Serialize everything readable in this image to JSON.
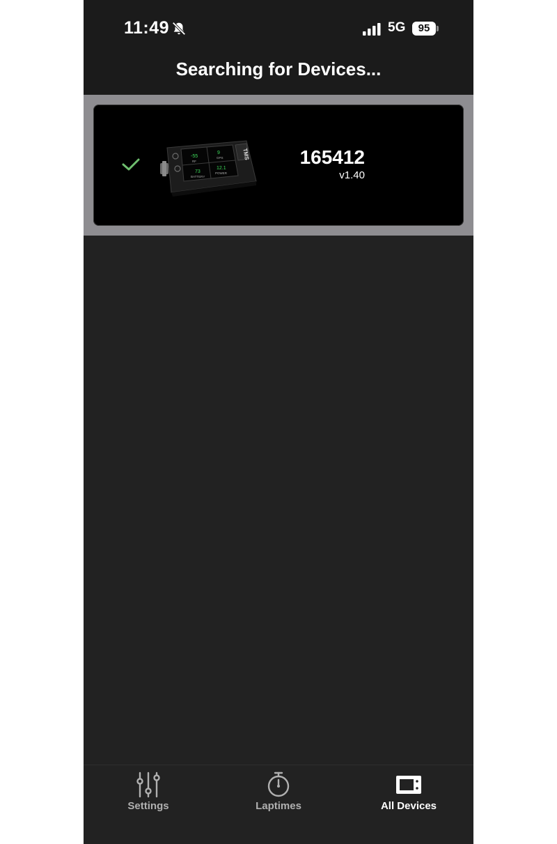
{
  "status_bar": {
    "time": "11:49",
    "network": "5G",
    "battery": "95"
  },
  "nav": {
    "title": "Searching for Devices..."
  },
  "devices": [
    {
      "id": "165412",
      "version": "v1.40",
      "selected": true,
      "image": {
        "brand": "TMS",
        "screen": {
          "rf": "-55",
          "rf_label": "RF",
          "gps": "9",
          "gps_label": "GPS",
          "battery": "73",
          "battery_label": "BATTERY",
          "power": "12.1",
          "power_label": "POWER"
        }
      }
    }
  ],
  "tabs": [
    {
      "label": "Settings",
      "icon": "sliders-icon",
      "active": false
    },
    {
      "label": "Laptimes",
      "icon": "stopwatch-icon",
      "active": false
    },
    {
      "label": "All Devices",
      "icon": "device-icon",
      "active": true
    }
  ],
  "colors": {
    "accent_check": "#6fbf6f",
    "screen_green": "#3ddc5a",
    "band": "#8e8d91"
  }
}
